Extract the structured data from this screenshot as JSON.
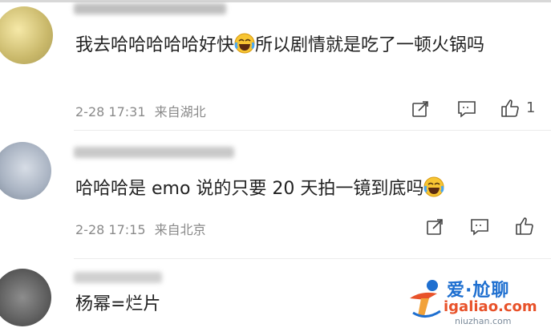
{
  "comments": [
    {
      "text_before": "我去哈哈哈哈哈好快",
      "text_after": "所以剧情就是吃了一顿火锅吗",
      "date": "2-28 17:31",
      "source": "来自湖北",
      "likes": "1"
    },
    {
      "text_before": "哈哈哈是 emo 说的只要 20 天拍一镜到底吗",
      "date": "2-28 17:15",
      "source": "来自北京"
    },
    {
      "text_before": "杨幂=烂片"
    }
  ],
  "icons": {
    "forward": "share-icon",
    "comment": "comment-icon",
    "like": "thumbs-up-icon",
    "emoji": "laughing-tears-emoji-icon"
  },
  "watermark": {
    "title": "爱·尬聊",
    "url": "igaliao.com",
    "sub": "niuzhan.com"
  },
  "colors": {
    "meta_text": "#8a8a8a",
    "watermark_blue": "#1e6fd0",
    "watermark_orange": "#e8522a"
  }
}
